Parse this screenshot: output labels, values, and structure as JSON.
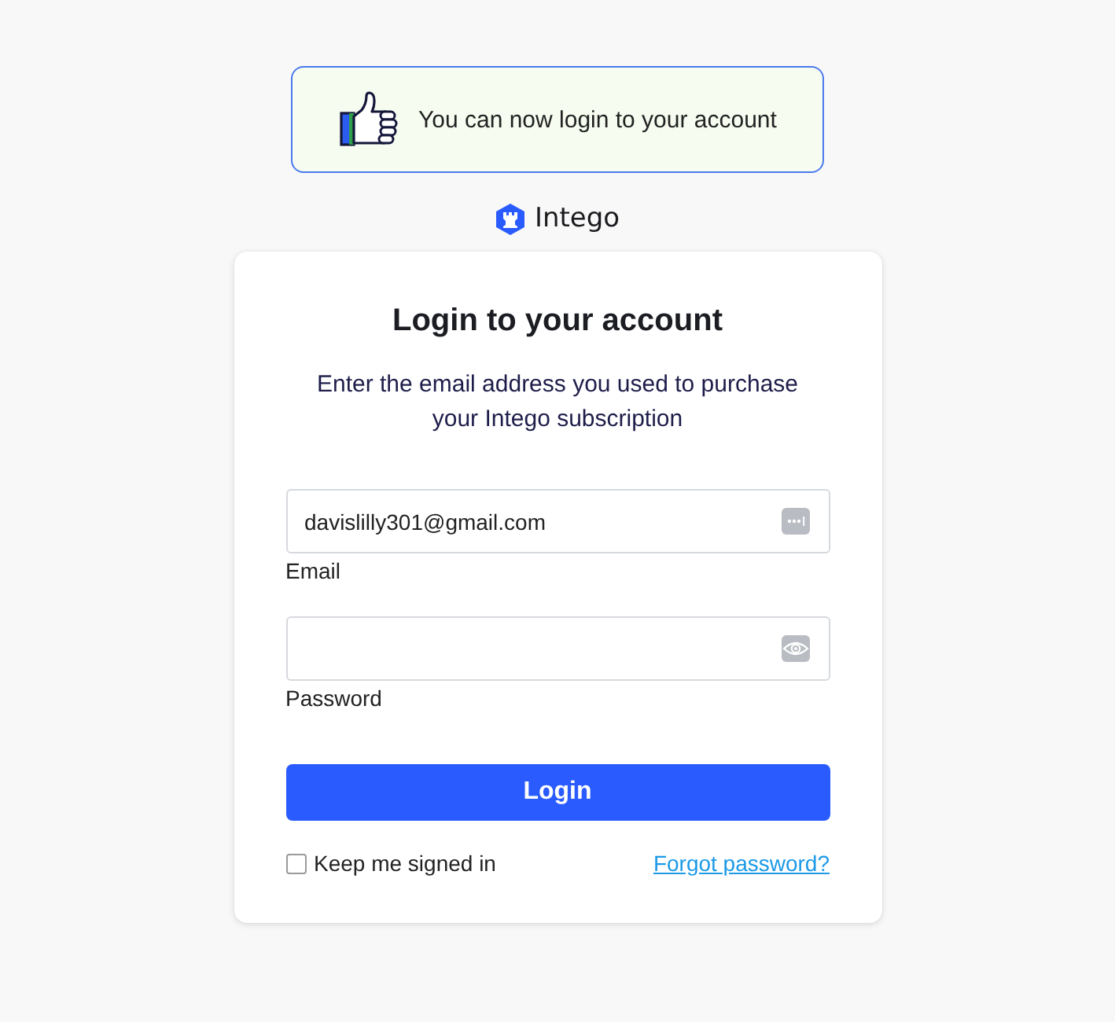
{
  "banner": {
    "message": "You can now login to your account"
  },
  "brand": {
    "name": "Intego"
  },
  "login_card": {
    "title": "Login to your account",
    "subtitle": "Enter the email address you used to purchase your Intego subscription",
    "fields": [
      {
        "kind": "email",
        "value": "davislilly301@gmail.com",
        "label": "Email"
      },
      {
        "kind": "password",
        "label": "Password"
      }
    ],
    "submit_button": "Login",
    "remember": {
      "label": "Keep me signed in",
      "checked": false
    },
    "forgot_link": "Forgot password?"
  }
}
